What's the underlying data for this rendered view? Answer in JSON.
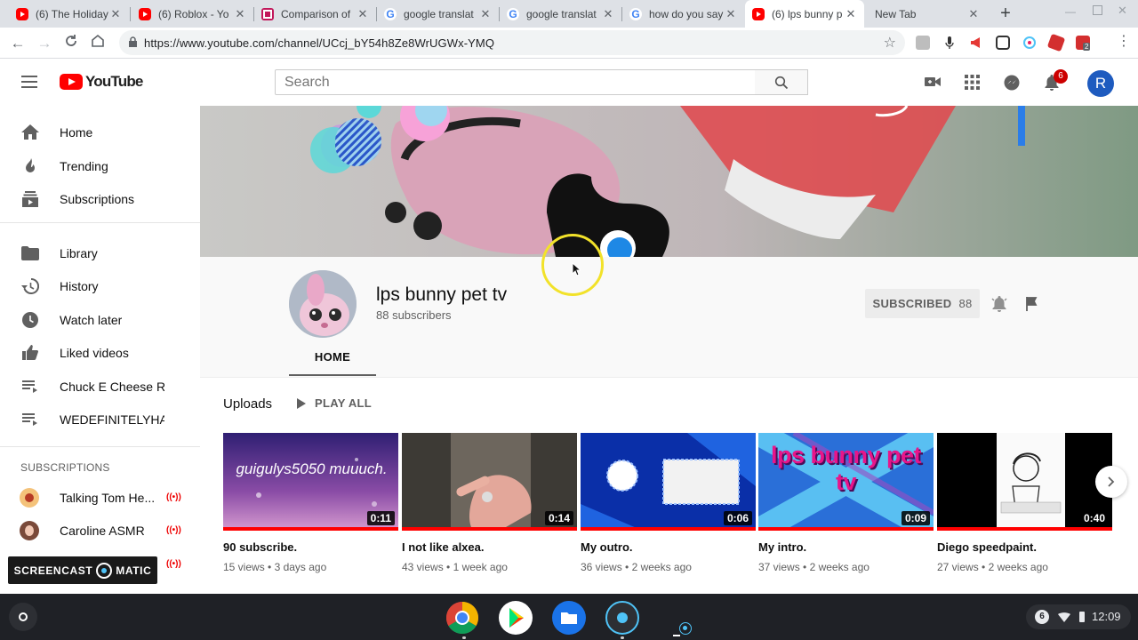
{
  "browser": {
    "tabs": [
      {
        "title": "(6) The Holiday",
        "icon": "youtube"
      },
      {
        "title": "(6) Roblox - Yo",
        "icon": "youtube"
      },
      {
        "title": "Comparison of",
        "icon": "comparison"
      },
      {
        "title": "google translat",
        "icon": "google"
      },
      {
        "title": "google translat",
        "icon": "google"
      },
      {
        "title": "how do you say",
        "icon": "google"
      },
      {
        "title": "(6) lps bunny p",
        "icon": "youtube",
        "active": true
      },
      {
        "title": "New Tab",
        "icon": "none"
      }
    ],
    "url": "https://www.youtube.com/channel/UCcj_bY54h8Ze8WrUGWx-YMQ",
    "extension_badge": "2"
  },
  "youtube": {
    "logo_text": "YouTube",
    "search_placeholder": "Search",
    "notification_count": "6",
    "avatar_letter": "R"
  },
  "sidebar": {
    "main": [
      {
        "label": "Home",
        "icon": "home-icon"
      },
      {
        "label": "Trending",
        "icon": "flame-icon"
      },
      {
        "label": "Subscriptions",
        "icon": "subscriptions-icon"
      }
    ],
    "library": [
      {
        "label": "Library",
        "icon": "folder-icon"
      },
      {
        "label": "History",
        "icon": "history-icon"
      },
      {
        "label": "Watch later",
        "icon": "clock-icon"
      },
      {
        "label": "Liked videos",
        "icon": "thumbs-up-icon"
      },
      {
        "label": "Chuck E Cheese R...",
        "icon": "playlist-icon"
      },
      {
        "label": "WEDEFINITELYHA...",
        "icon": "playlist-icon"
      }
    ],
    "subscriptions_heading": "SUBSCRIPTIONS",
    "subscriptions": [
      {
        "label": "Talking Tom He...",
        "live": true
      },
      {
        "label": "Caroline ASMR",
        "live": true
      },
      {
        "label": "",
        "live": true
      }
    ]
  },
  "channel": {
    "name": "lps bunny pet tv",
    "subscribers": "88 subscribers",
    "subscribe_label": "SUBSCRIBED",
    "subscribe_count": "88",
    "tab_home": "HOME"
  },
  "uploads": {
    "heading": "Uploads",
    "play_all": "PLAY ALL",
    "videos": [
      {
        "title": "90 subscribe.",
        "duration": "0:11",
        "views": "15 views",
        "age": "3 days ago",
        "thumb_text": "guigulys5050 muuuch."
      },
      {
        "title": "I not like alxea.",
        "duration": "0:14",
        "views": "43 views",
        "age": "1 week ago"
      },
      {
        "title": "My outro.",
        "duration": "0:06",
        "views": "36 views",
        "age": "2 weeks ago"
      },
      {
        "title": "My intro.",
        "duration": "0:09",
        "views": "37 views",
        "age": "2 weeks ago",
        "thumb_text": "lps bunny pet tv"
      },
      {
        "title": "Diego speedpaint.",
        "duration": "0:40",
        "views": "27 views",
        "age": "2 weeks ago"
      }
    ]
  },
  "screencast": {
    "label_left": "SCREENCAST",
    "label_right": "MATIC"
  },
  "shelf": {
    "time": "12:09",
    "tray_badge": "6"
  }
}
